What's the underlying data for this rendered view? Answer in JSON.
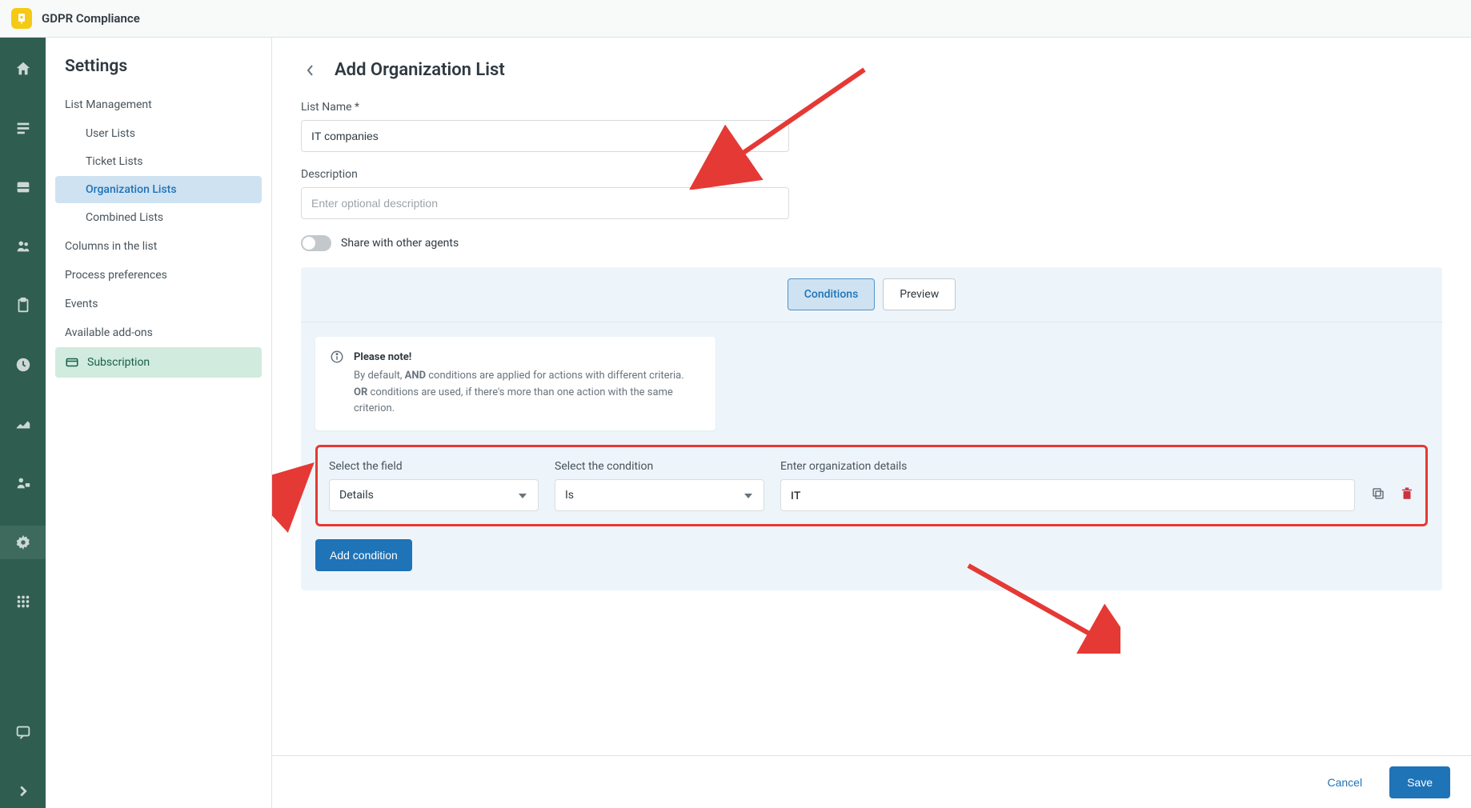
{
  "app": {
    "title": "GDPR Compliance"
  },
  "sidebar": {
    "title": "Settings",
    "groups": {
      "list_management": "List Management",
      "user_lists": "User Lists",
      "ticket_lists": "Ticket Lists",
      "organization_lists": "Organization Lists",
      "combined_lists": "Combined Lists",
      "columns": "Columns in the list",
      "process_prefs": "Process preferences",
      "events": "Events",
      "addons": "Available add-ons",
      "subscription": "Subscription"
    }
  },
  "page": {
    "title": "Add Organization List",
    "list_name_label": "List Name *",
    "list_name_value": "IT companies",
    "description_label": "Description",
    "description_placeholder": "Enter optional description",
    "share_label": "Share with other agents"
  },
  "tabs": {
    "conditions": "Conditions",
    "preview": "Preview"
  },
  "note": {
    "title": "Please note!",
    "line1_a": "By default, ",
    "line1_b": "AND",
    "line1_c": " conditions are applied for actions with different criteria.",
    "line2_a": "OR",
    "line2_b": " conditions are used, if there's more than one action with the same criterion."
  },
  "condition": {
    "field_label": "Select the field",
    "field_value": "Details",
    "cond_label": "Select the condition",
    "cond_value": "Is",
    "value_label": "Enter organization details",
    "value_value": "IT"
  },
  "buttons": {
    "add_condition": "Add condition",
    "cancel": "Cancel",
    "save": "Save"
  }
}
